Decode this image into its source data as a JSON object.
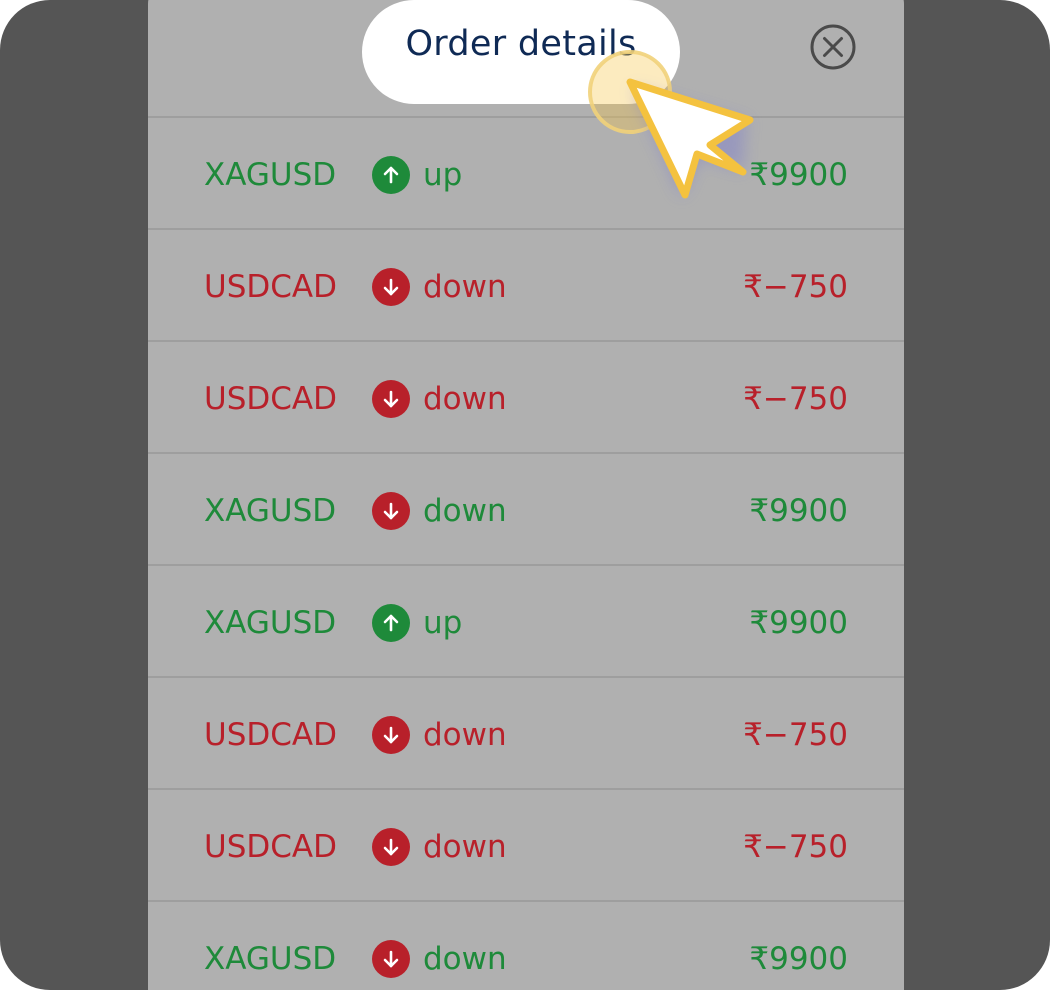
{
  "header": {
    "title": "Order details",
    "close_icon": "close-circle-icon"
  },
  "colors": {
    "positive": "#1e8a3a",
    "negative": "#b8202a",
    "panel": "#b0b0b0",
    "backdrop": "#555555",
    "title": "#0f2a55",
    "cursor": "#f6c549"
  },
  "orders": [
    {
      "symbol": "XAGUSD",
      "direction": "up",
      "direction_icon": "arrow-up-icon",
      "amount": "₹9900",
      "tone": "pos"
    },
    {
      "symbol": "USDCAD",
      "direction": "down",
      "direction_icon": "arrow-down-icon",
      "amount": "₹−750",
      "tone": "neg"
    },
    {
      "symbol": "USDCAD",
      "direction": "down",
      "direction_icon": "arrow-down-icon",
      "amount": "₹−750",
      "tone": "neg"
    },
    {
      "symbol": "XAGUSD",
      "direction": "down",
      "direction_icon": "arrow-down-icon",
      "amount": "₹9900",
      "tone": "pos"
    },
    {
      "symbol": "XAGUSD",
      "direction": "up",
      "direction_icon": "arrow-up-icon",
      "amount": "₹9900",
      "tone": "pos"
    },
    {
      "symbol": "USDCAD",
      "direction": "down",
      "direction_icon": "arrow-down-icon",
      "amount": "₹−750",
      "tone": "neg"
    },
    {
      "symbol": "USDCAD",
      "direction": "down",
      "direction_icon": "arrow-down-icon",
      "amount": "₹−750",
      "tone": "neg"
    },
    {
      "symbol": "XAGUSD",
      "direction": "down",
      "direction_icon": "arrow-down-icon",
      "amount": "₹9900",
      "tone": "pos"
    }
  ]
}
